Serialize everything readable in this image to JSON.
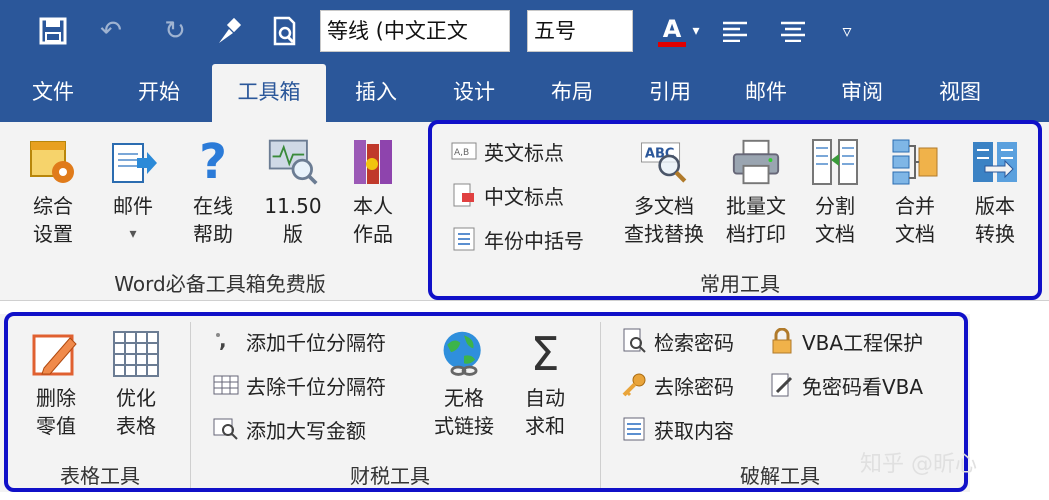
{
  "qat": {
    "font_name": "等线 (中文正文",
    "font_size": "五号",
    "font_color_letter": "A"
  },
  "tabs": [
    "文件",
    "开始",
    "工具箱",
    "插入",
    "设计",
    "布局",
    "引用",
    "邮件",
    "审阅",
    "视图"
  ],
  "group1": {
    "title": "Word必备工具箱免费版",
    "buttons": [
      {
        "line1": "综合",
        "line2": "设置"
      },
      {
        "line1": "邮件",
        "line2": "▾"
      },
      {
        "line1": "在线",
        "line2": "帮助"
      },
      {
        "line1": "11.50",
        "line2": "版"
      },
      {
        "line1": "本人",
        "line2": "作品"
      }
    ]
  },
  "group2": {
    "title": "常用工具",
    "small": [
      "英文标点",
      "中文标点",
      "年份中括号"
    ],
    "buttons": [
      {
        "line1": "多文档",
        "line2": "查找替换"
      },
      {
        "line1": "批量文",
        "line2": "档打印"
      },
      {
        "line1": "分割",
        "line2": "文档"
      },
      {
        "line1": "合并",
        "line2": "文档"
      },
      {
        "line1": "版本",
        "line2": "转换"
      }
    ],
    "abc_icon_text": "ABC"
  },
  "group3": {
    "title": "表格工具",
    "buttons": [
      {
        "line1": "删除",
        "line2": "零值"
      },
      {
        "line1": "优化",
        "line2": "表格"
      }
    ]
  },
  "group4": {
    "title": "财税工具",
    "small": [
      "添加千位分隔符",
      "去除千位分隔符",
      "添加大写金额"
    ],
    "buttons": [
      {
        "line1": "无格",
        "line2": "式链接"
      },
      {
        "line1": "自动",
        "line2": "求和"
      }
    ]
  },
  "group5": {
    "title": "破解工具",
    "small_left": [
      "检索密码",
      "去除密码",
      "获取内容"
    ],
    "small_right": [
      "VBA工程保护",
      "免密码看VBA"
    ]
  },
  "watermark": "知乎 @昕心",
  "colors": {
    "title_bar": "#2b579a",
    "ribbon_bg": "#f3f3f3",
    "highlight": "#1010c8",
    "font_color": "#e00000"
  }
}
